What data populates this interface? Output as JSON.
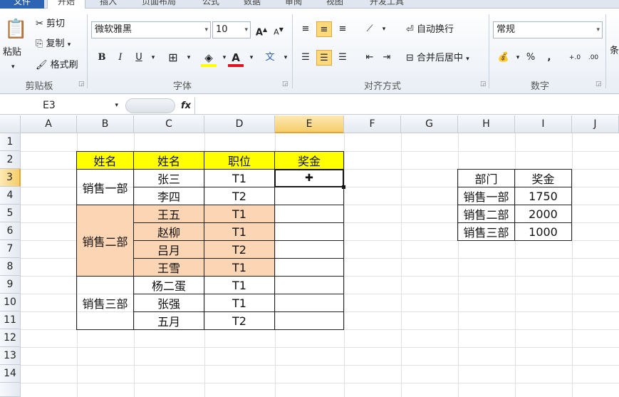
{
  "tabs": [
    "文件",
    "开始",
    "插入",
    "页面布局",
    "公式",
    "数据",
    "审阅",
    "视图",
    "开发工具"
  ],
  "clipboard": {
    "paste": "粘贴",
    "cut": "剪切",
    "copy": "复制",
    "painter": "格式刷",
    "label": "剪贴板"
  },
  "font": {
    "name": "微软雅黑",
    "size": "10",
    "bold": "B",
    "italic": "I",
    "underline": "U",
    "label": "字体"
  },
  "alignment": {
    "wrap": "自动换行",
    "merge": "合并后居中",
    "label": "对齐方式"
  },
  "number": {
    "format": "常规",
    "percent": "%",
    "comma": ",",
    "inc": "+.0",
    "dec": ".00",
    "label": "数字"
  },
  "edge_label": "条",
  "namebox": "E3",
  "fx": "fx",
  "columns": [
    "A",
    "B",
    "C",
    "D",
    "E",
    "F",
    "G",
    "H",
    "I",
    "J"
  ],
  "rows": [
    "1",
    "2",
    "3",
    "4",
    "5",
    "6",
    "7",
    "8",
    "9",
    "10",
    "11",
    "12",
    "13",
    "14"
  ],
  "table1": {
    "headers": [
      "姓名",
      "姓名",
      "职位",
      "奖金"
    ],
    "depts": [
      "销售一部",
      "销售二部",
      "销售三部"
    ],
    "names": [
      "张三",
      "李四",
      "王五",
      "赵柳",
      "吕月",
      "王雪",
      "杨二蛋",
      "张强",
      "五月"
    ],
    "positions": [
      "T1",
      "T2",
      "T1",
      "T1",
      "T2",
      "T1",
      "T1",
      "T1",
      "T2"
    ]
  },
  "table2": {
    "headers": [
      "部门",
      "奖金"
    ],
    "rows": [
      [
        "销售一部",
        "1750"
      ],
      [
        "销售二部",
        "2000"
      ],
      [
        "销售三部",
        "1000"
      ]
    ]
  },
  "colors": {
    "header_fill": "#ffff00",
    "dept2_fill": "#fcd5b4",
    "accent": "#2d64b3"
  }
}
